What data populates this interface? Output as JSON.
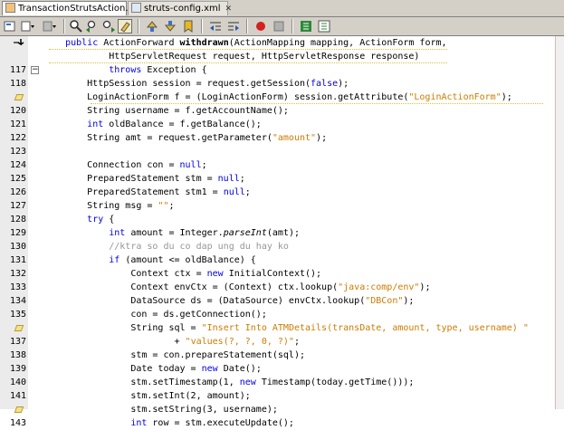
{
  "tabs": [
    {
      "label": "TransactionStrutsAction.java",
      "active": true,
      "icon": "java-file-icon"
    },
    {
      "label": "struts-config.xml",
      "active": false,
      "icon": "xml-file-icon"
    }
  ],
  "toolbar": {
    "icons": [
      "toggle-bookmark-icon",
      "history-dropdown-icon",
      "back-dropdown-icon",
      "find-icon",
      "find-previous-icon",
      "find-next-icon",
      "toggle-highlight-icon",
      "previous-bookmark-icon",
      "next-bookmark-icon",
      "toggle-bookmark-alt-icon",
      "shift-left-icon",
      "shift-right-icon",
      "start-macro-icon",
      "stop-macro-icon",
      "comment-icon",
      "uncomment-icon"
    ]
  },
  "editor": {
    "lines": [
      {
        "n": "",
        "marker": "bookmark-arrow-icon",
        "segs": [
          [
            "p",
            "    "
          ],
          [
            "k",
            "public"
          ],
          [
            "p",
            " ActionForward "
          ],
          [
            "b",
            "withdrawn"
          ],
          [
            "p",
            "(ActionMapping mapping, ActionForm form,"
          ]
        ]
      },
      {
        "n": "",
        "marker": "",
        "segs": [
          [
            "p",
            "            HttpServletRequest request, HttpServletResponse response)"
          ]
        ]
      },
      {
        "n": "117",
        "marker": "fold-minus-icon",
        "segs": [
          [
            "p",
            "            "
          ],
          [
            "k",
            "throws"
          ],
          [
            "p",
            " Exception {"
          ]
        ]
      },
      {
        "n": "118",
        "marker": "",
        "segs": [
          [
            "p",
            "        HttpSession session = request.getSession("
          ],
          [
            "k",
            "false"
          ],
          [
            "p",
            ");"
          ]
        ]
      },
      {
        "n": "",
        "marker": "hint-icon",
        "segs": [
          [
            "p",
            "        LoginActionForm f = (LoginActionForm) session.getAttribute("
          ],
          [
            "s",
            "\"LoginActionForm\""
          ],
          [
            "p",
            ");"
          ]
        ]
      },
      {
        "n": "120",
        "marker": "",
        "segs": [
          [
            "p",
            "        String username = f.getAccountName();"
          ]
        ]
      },
      {
        "n": "121",
        "marker": "",
        "segs": [
          [
            "p",
            "        "
          ],
          [
            "k",
            "int"
          ],
          [
            "p",
            " oldBalance = f.getBalance();"
          ]
        ]
      },
      {
        "n": "122",
        "marker": "",
        "segs": [
          [
            "p",
            "        String amt = request.getParameter("
          ],
          [
            "s",
            "\"amount\""
          ],
          [
            "p",
            ");"
          ]
        ]
      },
      {
        "n": "123",
        "marker": "",
        "segs": [
          [
            "p",
            ""
          ]
        ]
      },
      {
        "n": "124",
        "marker": "",
        "segs": [
          [
            "p",
            "        Connection con = "
          ],
          [
            "k",
            "null"
          ],
          [
            "p",
            ";"
          ]
        ]
      },
      {
        "n": "125",
        "marker": "",
        "segs": [
          [
            "p",
            "        PreparedStatement stm = "
          ],
          [
            "k",
            "null"
          ],
          [
            "p",
            ";"
          ]
        ]
      },
      {
        "n": "126",
        "marker": "",
        "segs": [
          [
            "p",
            "        PreparedStatement stm1 = "
          ],
          [
            "k",
            "null"
          ],
          [
            "p",
            ";"
          ]
        ]
      },
      {
        "n": "127",
        "marker": "",
        "segs": [
          [
            "p",
            "        String msg = "
          ],
          [
            "s",
            "\"\""
          ],
          [
            "p",
            ";"
          ]
        ]
      },
      {
        "n": "128",
        "marker": "",
        "segs": [
          [
            "p",
            "        "
          ],
          [
            "k",
            "try"
          ],
          [
            "p",
            " {"
          ]
        ]
      },
      {
        "n": "129",
        "marker": "",
        "segs": [
          [
            "p",
            "            "
          ],
          [
            "k",
            "int"
          ],
          [
            "p",
            " amount = Integer."
          ],
          [
            "i",
            "parseInt"
          ],
          [
            "p",
            "(amt);"
          ]
        ]
      },
      {
        "n": "130",
        "marker": "",
        "segs": [
          [
            "c",
            "            //ktra so du co dap ung du hay ko"
          ]
        ]
      },
      {
        "n": "131",
        "marker": "",
        "segs": [
          [
            "p",
            "            "
          ],
          [
            "k",
            "if"
          ],
          [
            "p",
            " (amount <= oldBalance) {"
          ]
        ]
      },
      {
        "n": "132",
        "marker": "",
        "segs": [
          [
            "p",
            "                Context ctx = "
          ],
          [
            "k",
            "new"
          ],
          [
            "p",
            " InitialContext();"
          ]
        ]
      },
      {
        "n": "133",
        "marker": "",
        "segs": [
          [
            "p",
            "                Context envCtx = (Context) ctx.lookup("
          ],
          [
            "s",
            "\"java:comp/env\""
          ],
          [
            "p",
            ");"
          ]
        ]
      },
      {
        "n": "134",
        "marker": "",
        "segs": [
          [
            "p",
            "                DataSource ds = (DataSource) envCtx.lookup("
          ],
          [
            "s",
            "\"DBCon\""
          ],
          [
            "p",
            ");"
          ]
        ]
      },
      {
        "n": "135",
        "marker": "",
        "segs": [
          [
            "p",
            "                con = ds.getConnection();"
          ]
        ]
      },
      {
        "n": "",
        "marker": "hint-icon",
        "segs": [
          [
            "p",
            "                String sql = "
          ],
          [
            "s",
            "\"Insert Into ATMDetails(transDate, amount, type, username) \""
          ]
        ]
      },
      {
        "n": "137",
        "marker": "",
        "segs": [
          [
            "p",
            "                        + "
          ],
          [
            "s",
            "\"values(?, ?, 0, ?)\""
          ],
          [
            "p",
            ";"
          ]
        ]
      },
      {
        "n": "138",
        "marker": "",
        "segs": [
          [
            "p",
            "                stm = con.prepareStatement(sql);"
          ]
        ]
      },
      {
        "n": "139",
        "marker": "",
        "segs": [
          [
            "p",
            "                Date today = "
          ],
          [
            "k",
            "new"
          ],
          [
            "p",
            " Date();"
          ]
        ]
      },
      {
        "n": "140",
        "marker": "",
        "segs": [
          [
            "p",
            "                stm.setTimestamp(1, "
          ],
          [
            "k",
            "new"
          ],
          [
            "p",
            " Timestamp(today.getTime()));"
          ]
        ]
      },
      {
        "n": "141",
        "marker": "",
        "segs": [
          [
            "p",
            "                stm.setInt(2, amount);"
          ]
        ]
      },
      {
        "n": "",
        "marker": "hint-icon",
        "segs": [
          [
            "p",
            "                stm.setString(3, username);"
          ]
        ]
      },
      {
        "n": "143",
        "marker": "",
        "segs": [
          [
            "p",
            "                "
          ],
          [
            "k",
            "int"
          ],
          [
            "p",
            " row = stm.executeUpdate();"
          ]
        ]
      }
    ]
  }
}
